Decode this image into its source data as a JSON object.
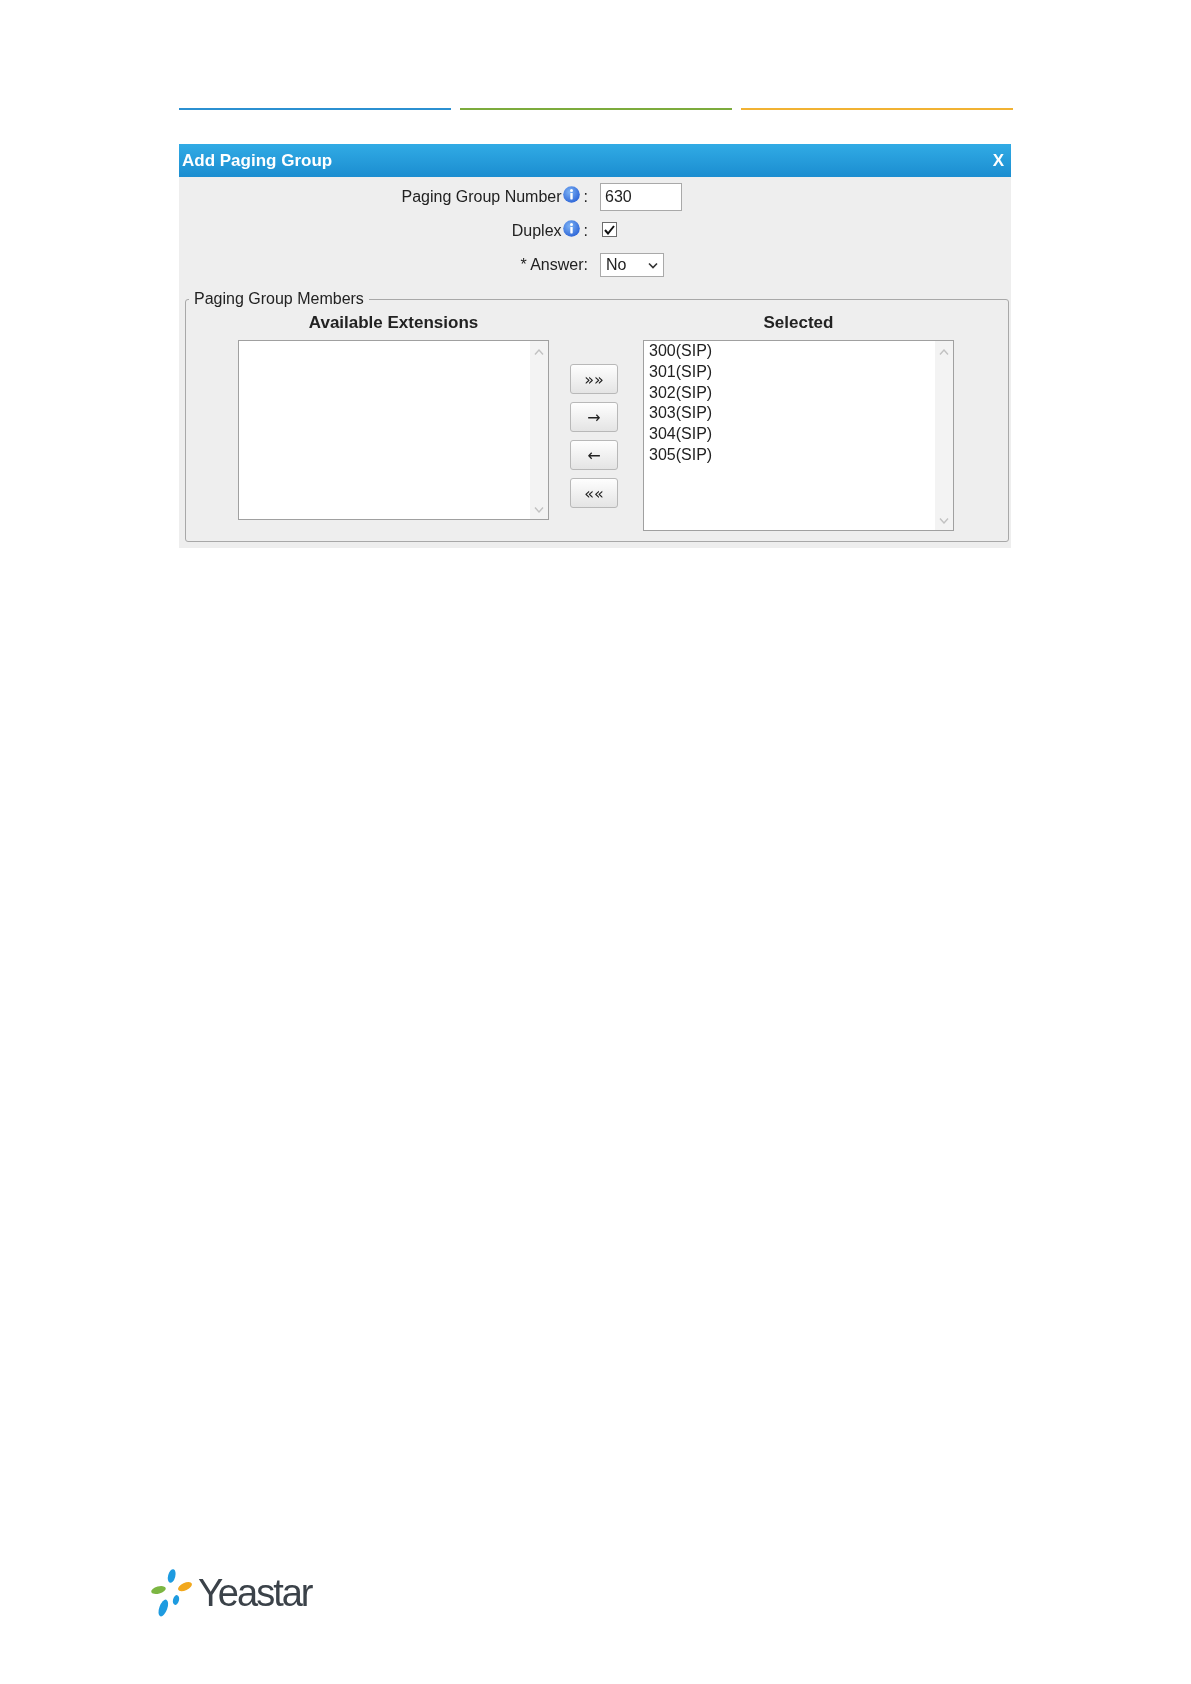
{
  "dialog": {
    "title": "Add Paging Group",
    "close": "X",
    "fields": [
      {
        "kind": "text",
        "label": "Paging Group Number",
        "info": true,
        "suffix": ":",
        "value": "630"
      },
      {
        "kind": "checkbox",
        "label": "Duplex",
        "info": true,
        "suffix": ":",
        "checked": true
      },
      {
        "kind": "select",
        "label": "* Answer:",
        "info": false,
        "value": "No"
      }
    ],
    "members": {
      "legend": "Paging Group Members",
      "available": {
        "heading": "Available Extensions"
      },
      "selected": {
        "heading": "Selected",
        "items": [
          {
            "label": "300(SIP)",
            "selected": false
          },
          {
            "label": "301(SIP)",
            "selected": false
          },
          {
            "label": "302(SIP)",
            "selected": false
          },
          {
            "label": "303(SIP)",
            "selected": false
          },
          {
            "label": "304(SIP)",
            "selected": false
          },
          {
            "label": "305(SIP)",
            "selected": false
          }
        ]
      },
      "buttons": [
        "»»",
        "→",
        "←",
        "««"
      ]
    }
  },
  "logo": {
    "text": "Yeastar"
  }
}
